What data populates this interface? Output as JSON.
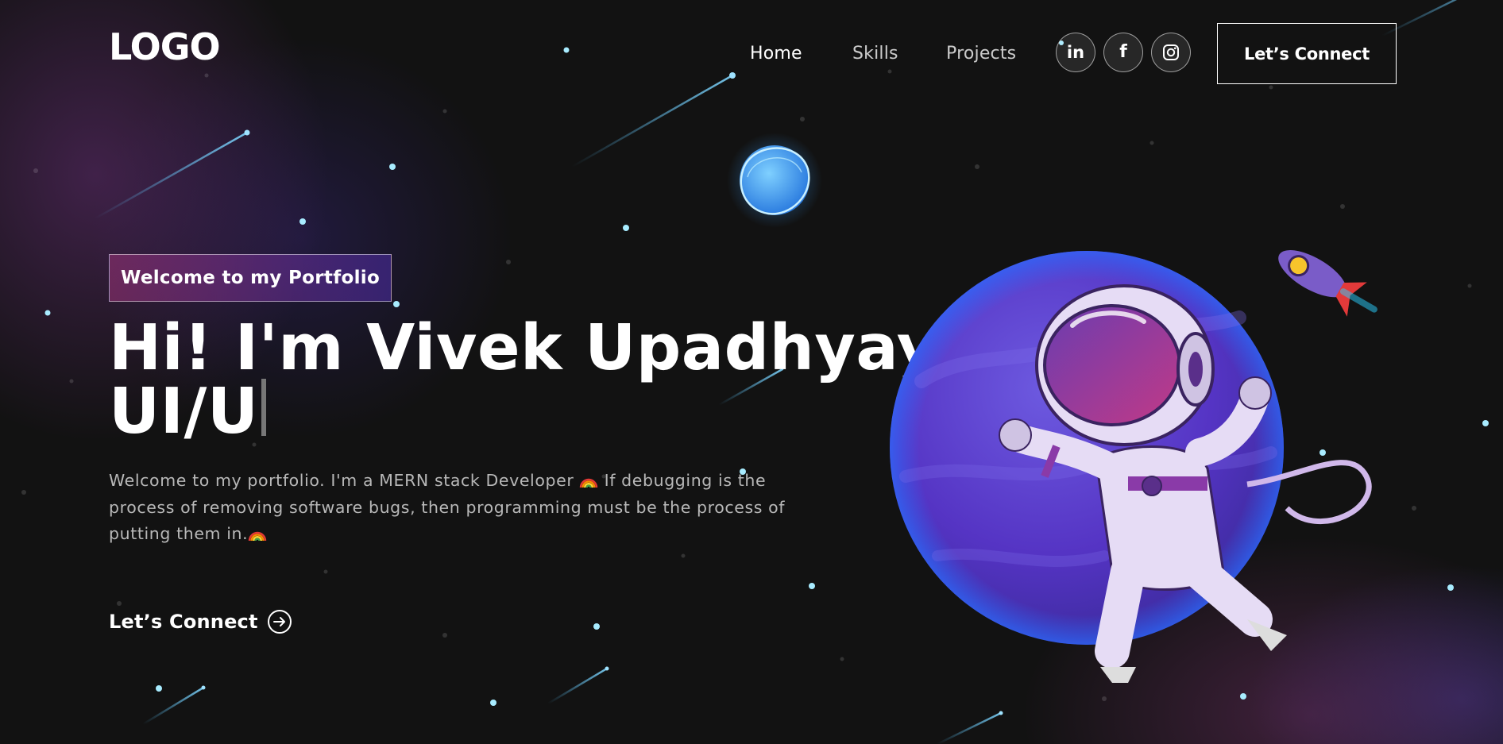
{
  "brand": {
    "logo_text": "LOGO"
  },
  "nav": {
    "links": [
      {
        "label": "Home",
        "active": true
      },
      {
        "label": "Skills",
        "active": false
      },
      {
        "label": "Projects",
        "active": false
      }
    ],
    "social": [
      {
        "icon": "linkedin-icon",
        "label": "in"
      },
      {
        "icon": "facebook-icon",
        "label": "f"
      },
      {
        "icon": "instagram-icon"
      }
    ],
    "connect_label": "Let’s Connect"
  },
  "hero": {
    "tagline": "Welcome to my Portfolio",
    "title_line1": "Hi! I'm Vivek Upadhyay",
    "title_line2": "UI/U",
    "description": "Welcome to my portfolio. I'm a MERN stack Developer",
    "description_cont": " If debugging is the process of removing software bugs, then programming must be the process of putting them in.",
    "connect_label": "Let’s Connect",
    "icons": {
      "emoji": "rainbow-icon",
      "connect": "arrow-right-circle-icon",
      "illustration": "astronaut-planet-illustration"
    }
  },
  "colors": {
    "background": "#121212",
    "accent_pink": "#AA367C",
    "accent_purple": "#4A2FBD",
    "text_muted": "#B8B8B8"
  }
}
